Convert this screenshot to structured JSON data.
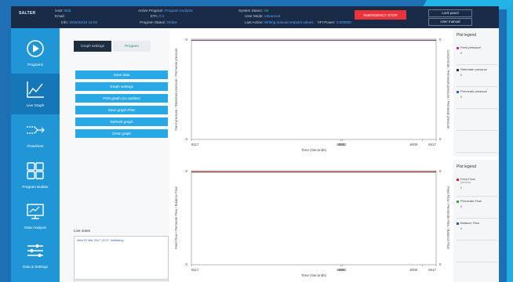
{
  "topbar": {
    "brand": "SALTER",
    "user_label": "User:",
    "user_value": "Bob",
    "email_label": "Email:",
    "info_label": "Info:",
    "info_value": "2016/03/19 16:00",
    "active_program_label": "Active Program:",
    "active_program_value": "Program Analysis",
    "eta_label": "ETA:",
    "eta_value": "0 s",
    "program_status_label": "Program Status:",
    "program_status_value": "Online",
    "system_status_label": "System Status:",
    "system_status_value": "OK",
    "user_mode_label": "User Mode:",
    "user_mode_value": "Advanced",
    "last_action_label": "Last Action:",
    "last_action_value": "Writing manual setpoint values",
    "vfi_label": "VFI Power:",
    "vfi_value": "0.000000",
    "emergency_stop": "EMERGENCY STOP",
    "lock_panel": "Lock panel",
    "user_manual": "User manual"
  },
  "sidebar": {
    "items": [
      {
        "label": "Programs",
        "icon": "play-icon"
      },
      {
        "label": "Live Graph",
        "icon": "line-graph-icon"
      },
      {
        "label": "Flowsheet",
        "icon": "flowsheet-icon"
      },
      {
        "label": "Program Builder",
        "icon": "grid-icon"
      },
      {
        "label": "Data Analysis",
        "icon": "monitor-icon"
      },
      {
        "label": "Data & Settings",
        "icon": "sliders-icon"
      }
    ]
  },
  "left_panel": {
    "tabs": [
      "Graph settings",
      "Program"
    ],
    "buttons": [
      "Save data",
      "Graph settings",
      "Print graph (no update)",
      "Save graph PNG",
      "Refresh graph",
      "Clear graph"
    ],
    "notes_label": "Live notes",
    "note_entry": "Wed 22 Mar 2017 13:07: Initializing"
  },
  "chart_data": [
    {
      "type": "line",
      "title": "",
      "xlabel": "Time (Seconds)",
      "ylabel": "Feed pressure / Retentate pressure / Permeate pressure",
      "ylabel_right": "Concentrate / Permeate pressure / Permeate pressure",
      "x_ticks": [
        "8117",
        "8300",
        "8302",
        "8400",
        "8417"
      ],
      "y_ticks_left": [
        "0",
        "0"
      ],
      "y_ticks_right": [
        "0",
        "0"
      ],
      "x": [
        8117,
        8417
      ],
      "series": [
        {
          "values": [
            0,
            0
          ],
          "color": "#7a4a8a"
        }
      ]
    },
    {
      "type": "line",
      "title": "",
      "xlabel": "Time (Seconds)",
      "ylabel": "Feed Flow / Permeate Flow / Balance Flow",
      "ylabel_right": "Feed Flow / Permeate Flow / Balance Flow",
      "x_ticks": [
        "8117",
        "8300",
        "8302",
        "8400",
        "8417"
      ],
      "y_ticks_left": [
        "0",
        "0"
      ],
      "y_ticks_right": [
        "0",
        "0"
      ],
      "x": [
        8117,
        8417
      ],
      "series": [
        {
          "values": [
            0,
            0
          ],
          "color": "#8a2a2a"
        }
      ]
    }
  ],
  "legend_top": {
    "title": "Plot legend",
    "items": [
      {
        "name": "Feed pressure",
        "value": "0",
        "color": "#c030a0"
      },
      {
        "name": "Retentate pressure",
        "value": "0",
        "color": "#333333"
      },
      {
        "name": "Permeate pressure",
        "value": "0",
        "color": "#2f5fd0"
      }
    ]
  },
  "legend_bottom": {
    "title": "Plot legend",
    "items": [
      {
        "name": "Feed Flow",
        "unit": "(ml/min)",
        "value": "0",
        "color": "#d02a2a"
      },
      {
        "name": "Permeate Flow",
        "value": "0",
        "color": "#3aa040"
      },
      {
        "name": "Balance Flow",
        "value": "0",
        "color": "#2f4fc0"
      }
    ]
  }
}
